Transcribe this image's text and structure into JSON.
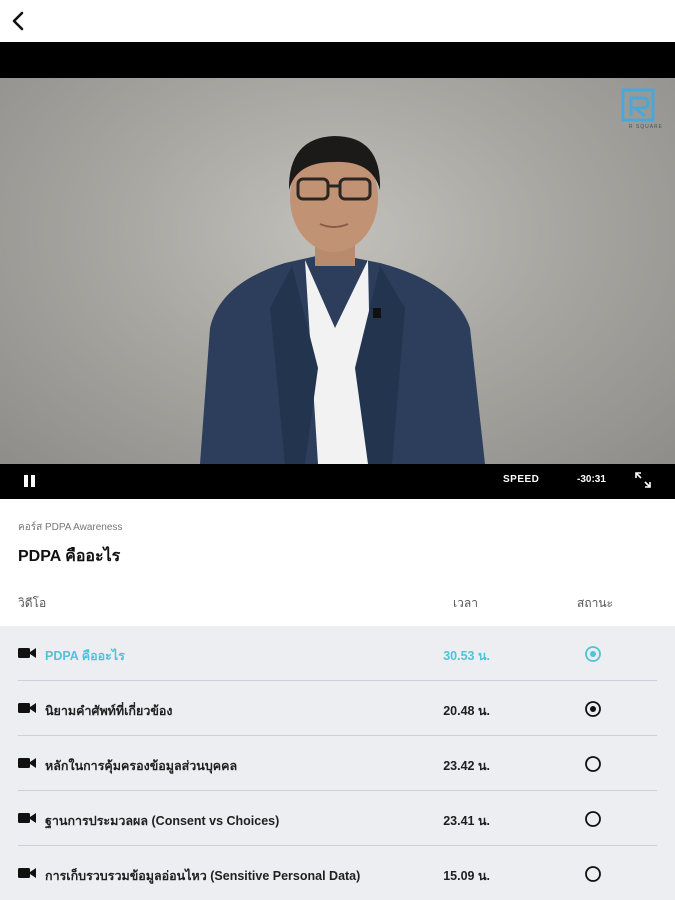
{
  "header": {
    "back_icon": "chevron-left-icon"
  },
  "player": {
    "logo_text": "R SQUARE",
    "progress": 0.02,
    "speed_label": "SPEED",
    "time_remaining": "-30:31",
    "pause_icon": "pause-icon",
    "fullscreen_icon": "expand-icon"
  },
  "course": {
    "name": "คอร์ส PDPA Awareness",
    "title": "PDPA คืออะไร"
  },
  "list": {
    "headers": {
      "video": "วิดีโอ",
      "time": "เวลา",
      "status": "สถานะ"
    },
    "items": [
      {
        "title": "PDPA คืออะไร",
        "duration": "30.53 น.",
        "status": "playing"
      },
      {
        "title": "นิยามคำศัพท์ที่เกี่ยวข้อง",
        "duration": "20.48 น.",
        "status": "completed"
      },
      {
        "title": "หลักในการคุ้มครองข้อมูลส่วนบุคคล",
        "duration": "23.42 น.",
        "status": "not-started"
      },
      {
        "title": "ฐานการประมวลผล (Consent vs Choices)",
        "duration": "23.41 น.",
        "status": "not-started"
      },
      {
        "title": "การเก็บรวบรวมข้อมูลอ่อนไหว (Sensitive Personal Data)",
        "duration": "15.09 น.",
        "status": "not-started"
      }
    ]
  },
  "colors": {
    "accent": "#4fc3d9",
    "list_bg": "#eceef1",
    "divider": "#c8d0da"
  }
}
